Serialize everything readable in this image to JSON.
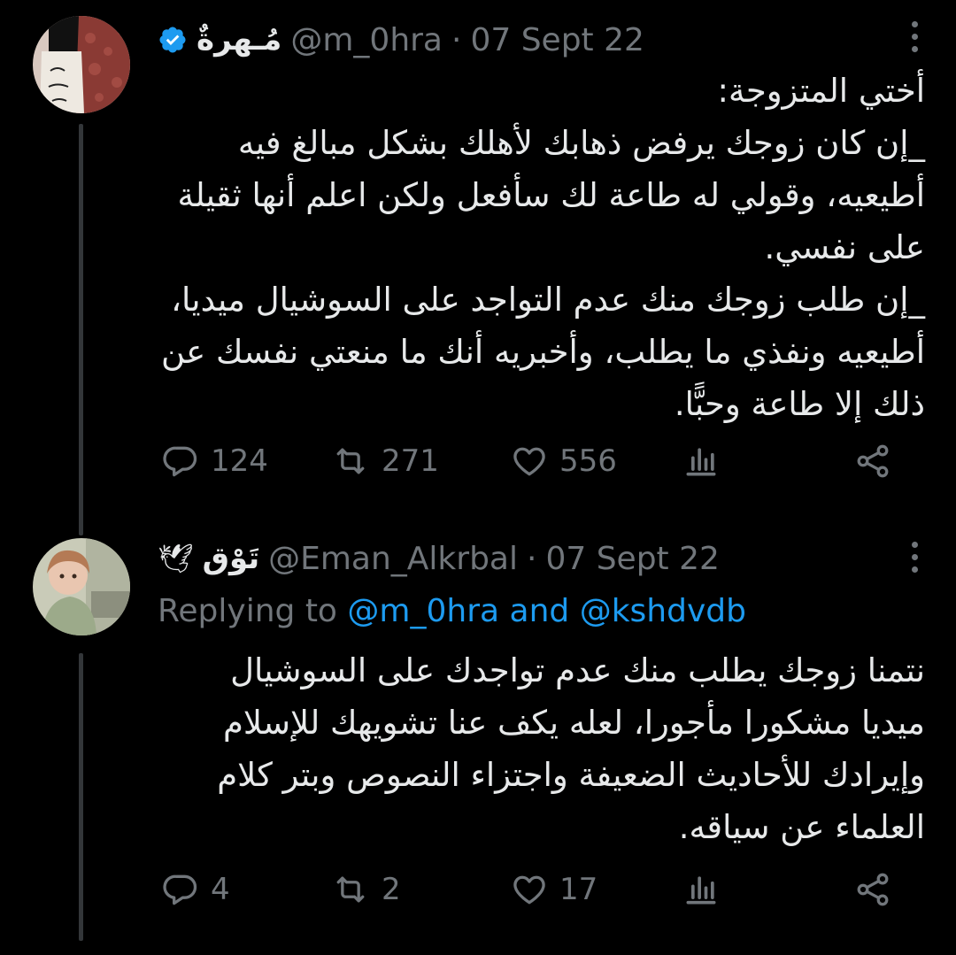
{
  "tweets": [
    {
      "display_name": "مُـهرةٌ",
      "verified": true,
      "handle": "@m_0hra",
      "separator": "·",
      "date": "07 Sept 22",
      "text": "أختي المتزوجة:\n_إن كان زوجك يرفض ذهابك لأهلك بشكل مبالغ فيه أطيعيه، وقولي له طاعة لك سأفعل ولكن اعلم أنها ثقيلة على نفسي.\n_إن طلب زوجك منك عدم التواجد على السوشيال ميديا، أطيعيه ونفذي ما يطلب، وأخبريه أنك ما منعتي نفسك عن ذلك إلا طاعة وحبًّا.",
      "stats": {
        "replies": "124",
        "retweets": "271",
        "likes": "556"
      }
    },
    {
      "display_name": "تَوْق",
      "name_emoji": "🕊",
      "handle": "@Eman_Alkrbal",
      "separator": "·",
      "date": "07 Sept 22",
      "replying_prefix": "Replying to",
      "replying_handles": "@m_0hra and @kshdvdb",
      "text": "نتمنا زوجك يطلب منك عدم تواجدك على السوشيال ميديا مشكورا مأجورا، لعله يكف عنا تشويهك للإسلام وإيرادك للأحاديث الضعيفة واجتزاء النصوص وبتر كلام العلماء عن سياقه.",
      "stats": {
        "replies": "4",
        "retweets": "2",
        "likes": "17"
      }
    }
  ],
  "colors": {
    "background": "#000000",
    "text": "#e7e9ea",
    "muted": "#71767b",
    "link": "#1d9bf0",
    "verified": "#1d9bf0",
    "thread_line": "#333639"
  },
  "icons": [
    "verified-badge-icon",
    "more-icon",
    "reply-icon",
    "retweet-icon",
    "like-icon",
    "views-icon",
    "share-icon",
    "dove-icon"
  ]
}
